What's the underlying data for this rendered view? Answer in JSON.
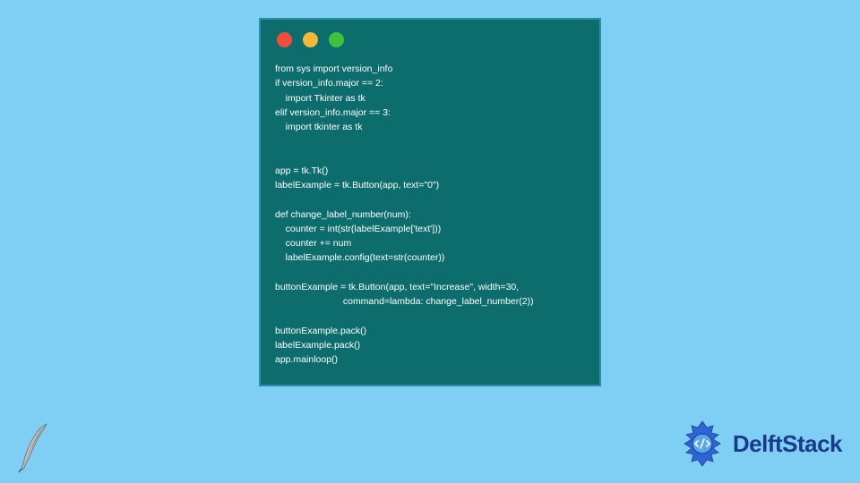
{
  "window": {
    "dots": [
      "red",
      "yellow",
      "green"
    ]
  },
  "code": {
    "line1": "from sys import version_info",
    "line2": "if version_info.major == 2:",
    "line3": "    import Tkinter as tk",
    "line4": "elif version_info.major == 3:",
    "line5": "    import tkinter as tk",
    "blank1": "",
    "blank2": "",
    "line6": "app = tk.Tk()",
    "line7": "labelExample = tk.Button(app, text=\"0\")",
    "blank3": "",
    "line8": "def change_label_number(num):",
    "line9": "    counter = int(str(labelExample['text']))",
    "line10": "    counter += num",
    "line11": "    labelExample.config(text=str(counter))",
    "blank4": "",
    "line12": "buttonExample = tk.Button(app, text=\"Increase\", width=30,",
    "line13": "                          command=lambda: change_label_number(2))",
    "blank5": "",
    "line14": "buttonExample.pack()",
    "line15": "labelExample.pack()",
    "line16": "app.mainloop()"
  },
  "brand": {
    "name": "DelftStack"
  },
  "colors": {
    "background": "#7fcef4",
    "windowBg": "#0d6d6d",
    "windowBorder": "#2a8ea8",
    "codeText": "#ffffff",
    "brandText": "#1a3b8a",
    "brandLogo": "#2a5fd6"
  }
}
